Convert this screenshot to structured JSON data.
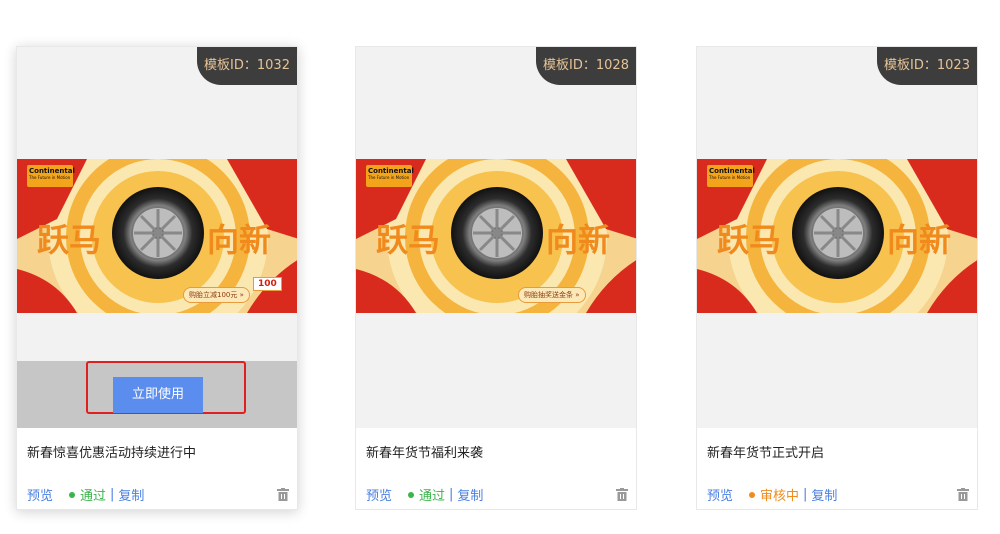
{
  "cards": [
    {
      "badge": "模板ID：1032",
      "use_button": "立即使用",
      "title": "新春惊喜优惠活动持续进行中",
      "preview": "预览",
      "status": "通过",
      "status_color": "#3ab54a",
      "copy": "复制",
      "banner_chip": "购胎立减100元 »",
      "banner_coupon": "100"
    },
    {
      "badge": "模板ID：1028",
      "title": "新春年货节福利来袭",
      "preview": "预览",
      "status": "通过",
      "status_color": "#3ab54a",
      "copy": "复制",
      "banner_chip": "购胎抽奖送金条 »"
    },
    {
      "badge": "模板ID：1023",
      "title": "新春年货节正式开启",
      "preview": "预览",
      "status": "审核中",
      "status_color": "#f08c1e",
      "copy": "复制"
    }
  ],
  "banner": {
    "brand": "Continental",
    "brand_tagline": "The Future in Motion",
    "headline_left": "跃马",
    "headline_right": "向新"
  },
  "icons": {
    "trash": "trash-icon"
  }
}
